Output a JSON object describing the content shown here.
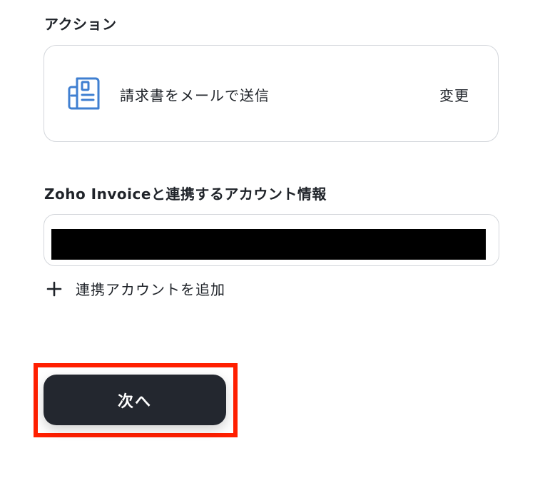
{
  "action_section": {
    "label": "アクション",
    "action_icon": "invoice-document-icon",
    "action_name": "請求書をメールで送信",
    "change_label": "変更"
  },
  "account_section": {
    "label": "Zoho Invoiceと連携するアカウント情報",
    "account_value": "",
    "add_account_icon": "plus-icon",
    "add_account_label": "連携アカウントを追加"
  },
  "footer": {
    "next_label": "次へ",
    "highlight_color": "#ff1f00",
    "button_color": "#23272f"
  }
}
